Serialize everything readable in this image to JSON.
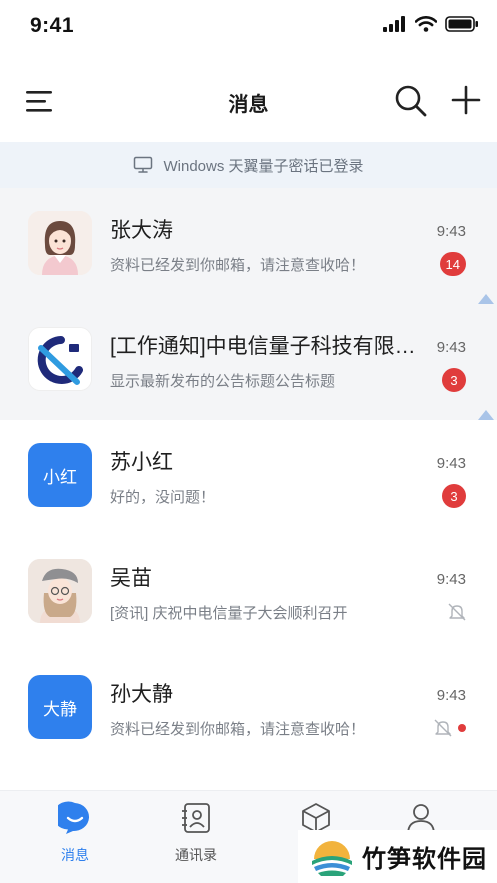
{
  "status_bar": {
    "time": "9:41"
  },
  "nav": {
    "title": "消息"
  },
  "login_banner": {
    "text": "Windows 天翼量子密话已登录"
  },
  "conversations": [
    {
      "name": "张大涛",
      "preview": "资料已经发到你邮箱，请注意查收哈！",
      "time": "9:43",
      "badge": "14",
      "avatar_type": "illustration-woman"
    },
    {
      "name": "[工作通知]中电信量子科技有限公司",
      "preview": "显示最新发布的公告标题公告标题",
      "time": "9:43",
      "badge": "3",
      "avatar_type": "company-logo"
    },
    {
      "name": "苏小红",
      "preview": "好的，没问题！",
      "time": "9:43",
      "badge": "3",
      "avatar_text": "小红"
    },
    {
      "name": "吴苗",
      "preview": "[资讯] 庆祝中电信量子大会顺利召开",
      "time": "9:43",
      "muted": true,
      "avatar_type": "illustration-girl"
    },
    {
      "name": "孙大静",
      "preview": "资料已经发到你邮箱，请注意查收哈！",
      "time": "9:43",
      "muted": true,
      "unread_dot": true,
      "avatar_text": "大静"
    }
  ],
  "tabs": [
    {
      "label": "消息",
      "icon": "chat-bubble-icon",
      "active": true
    },
    {
      "label": "通讯录",
      "icon": "contacts-icon",
      "active": false
    },
    {
      "label": "",
      "icon": "cube-icon",
      "active": false
    },
    {
      "label": "",
      "icon": "profile-icon",
      "active": false
    }
  ],
  "watermark": {
    "text": "竹笋软件园"
  },
  "colors": {
    "accent": "#2f80ed",
    "badge": "#e03c3c",
    "banner_bg": "#eef3f9",
    "pinned_bg": "#f4f5f7"
  }
}
